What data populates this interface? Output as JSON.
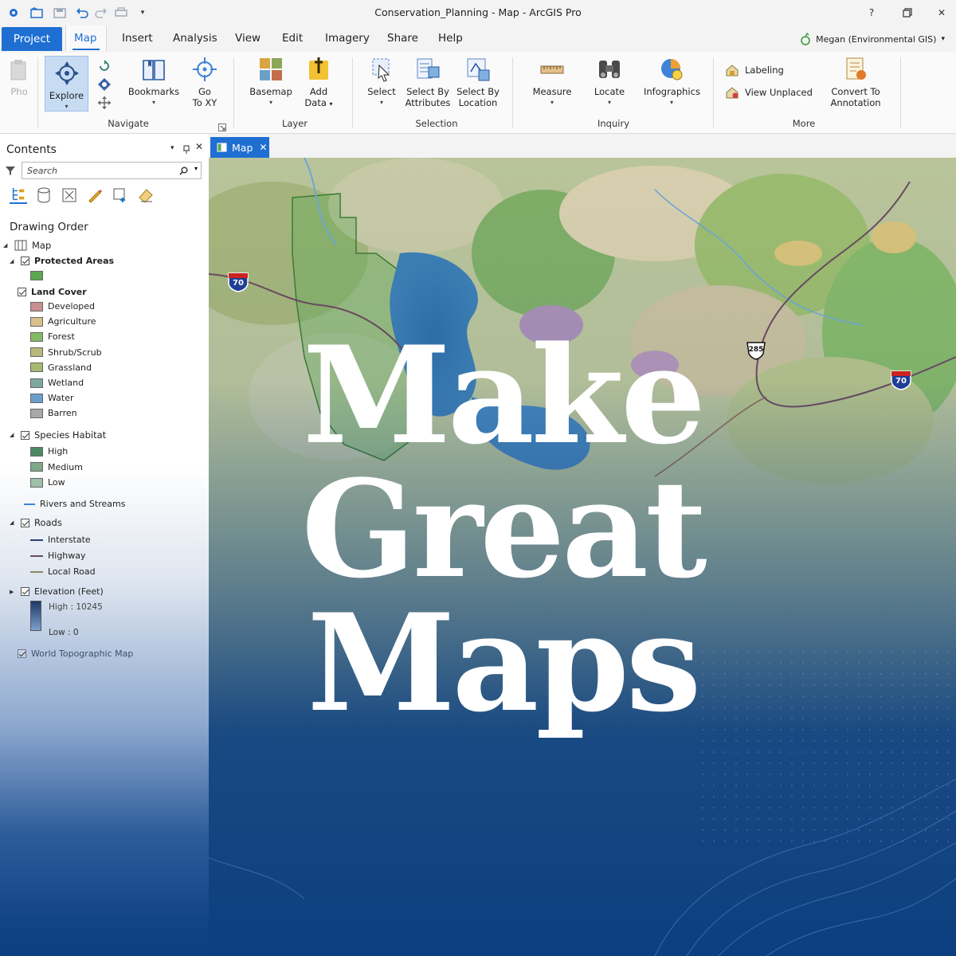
{
  "titlebar": {
    "title": "Conservation_Planning - Map - ArcGIS Pro",
    "help": "?",
    "restore": "❐",
    "close": "✕"
  },
  "tabs": {
    "project": "Project",
    "map": "Map",
    "insert": "Insert",
    "analysis": "Analysis",
    "view": "View",
    "edit": "Edit",
    "imagery": "Imagery",
    "share": "Share",
    "help": "Help"
  },
  "user": {
    "name": "Megan (Environmental GIS)",
    "caret": "▾"
  },
  "ribbon": {
    "paste": "Pho",
    "explore": "Explore",
    "bookmarks": "Bookmarks",
    "goto_line1": "Go",
    "goto_line2": "To XY",
    "basemap": "Basemap",
    "add_data_line1": "Add",
    "add_data_line2": "Data",
    "select": "Select",
    "select_attr_line1": "Select By",
    "select_attr_line2": "Attributes",
    "select_loc_line1": "Select By",
    "select_loc_line2": "Location",
    "measure": "Measure",
    "locate": "Locate",
    "infographics": "Infographics",
    "labeling": "Labeling",
    "view_unplaced": "View Unplaced",
    "convert_line1": "Convert To",
    "convert_line2": "Annotation",
    "groups": {
      "navigate": "Navigate",
      "layer": "Layer",
      "selection": "Selection",
      "inquiry": "Inquiry",
      "more": "More"
    }
  },
  "contents": {
    "title": "Contents",
    "search_placeholder": "Search",
    "drawing_order": "Drawing Order",
    "map": "Map",
    "protected_areas": "Protected Areas",
    "land_cover": "Land Cover",
    "land_cover_classes": [
      {
        "label": "Developed",
        "color": "#c98f93"
      },
      {
        "label": "Agriculture",
        "color": "#d9c28a"
      },
      {
        "label": "Forest",
        "color": "#86b86a"
      },
      {
        "label": "Shrub/Scrub",
        "color": "#b7b879"
      },
      {
        "label": "Grassland",
        "color": "#a6b96e"
      },
      {
        "label": "Wetland",
        "color": "#7fa7a0"
      },
      {
        "label": "Water",
        "color": "#6d9ccf"
      },
      {
        "label": "Barren",
        "color": "#a8a8a8"
      }
    ],
    "species_habitat": "Species Habitat",
    "habitat_classes": [
      {
        "label": "High",
        "color": "#4c8a63"
      },
      {
        "label": "Medium",
        "color": "#7da889"
      },
      {
        "label": "Low",
        "color": "#9cc0a8"
      }
    ],
    "rivers": "Rivers and Streams",
    "roads": "Roads",
    "road_classes": [
      {
        "label": "Interstate",
        "color": "#2f3e7a"
      },
      {
        "label": "Highway",
        "color": "#6b4a5e"
      },
      {
        "label": "Local Road",
        "color": "#8a8a60"
      }
    ],
    "elevation": "Elevation (Feet)",
    "elev_high": "High : 10245",
    "elev_low": "Low : 0",
    "world_topo": "World Topographic Map"
  },
  "map": {
    "tab_label": "Map",
    "shields": {
      "i70_west": "70",
      "us285": "285",
      "i70_east": "70"
    }
  },
  "headline": {
    "line1": "Make",
    "line2": "Great",
    "line3": "Maps"
  },
  "colors": {
    "accent": "#1f6fd2",
    "background_blue": "#0c3f80",
    "protected_area": "#5aa84f"
  }
}
